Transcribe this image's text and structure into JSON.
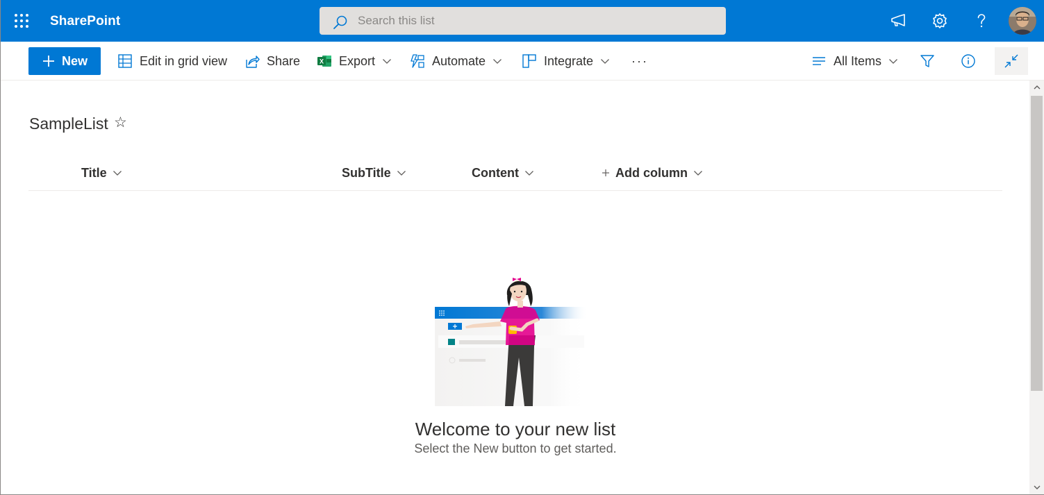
{
  "app": {
    "brand": "SharePoint",
    "search_placeholder": "Search this list",
    "icons": [
      "app-launcher-icon",
      "megaphone-icon",
      "gear-icon",
      "help-icon",
      "user-avatar"
    ]
  },
  "toolbar": {
    "new_label": "New",
    "edit_grid_label": "Edit in grid view",
    "share_label": "Share",
    "export_label": "Export",
    "automate_label": "Automate",
    "integrate_label": "Integrate",
    "more_label": "···",
    "view_label": "All Items"
  },
  "list": {
    "title": "SampleList",
    "columns": [
      {
        "label": "Title"
      },
      {
        "label": "SubTitle"
      },
      {
        "label": "Content"
      },
      {
        "label": "Add column"
      }
    ]
  },
  "empty_state": {
    "title": "Welcome to your new list",
    "subtitle": "Select the New button to get started."
  },
  "colors": {
    "accent": "#0078d4",
    "excel_green": "#107c41",
    "text": "#323130"
  }
}
